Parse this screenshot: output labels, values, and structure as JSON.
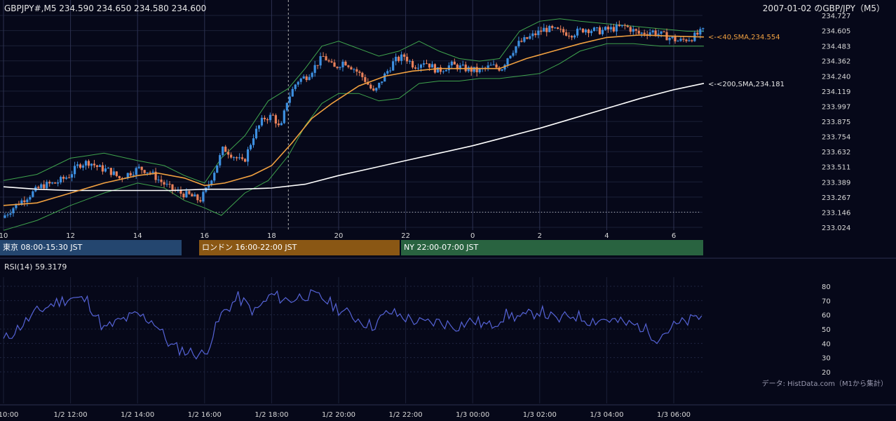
{
  "header": {
    "symbol_ohlc": "GBPJPY#,M5 234.590 234.650 234.580 234.600",
    "date_pair": "2007-01-02 のGBP/JPY（M5）"
  },
  "chart_data": [
    {
      "type": "candlestick",
      "title": "GBPJPY#,M5 234.590 234.650 234.580 234.600",
      "ylim": [
        233.024,
        234.727
      ],
      "y_ticks": [
        "234.727",
        "234.605",
        "234.483",
        "234.362",
        "234.240",
        "234.119",
        "233.997",
        "233.875",
        "233.754",
        "233.632",
        "233.511",
        "233.389",
        "233.267",
        "233.146",
        "233.024"
      ],
      "x_ticks": [
        "10",
        "12",
        "14",
        "16",
        "18",
        "20",
        "22",
        "0",
        "2",
        "4",
        "6"
      ],
      "colors": {
        "up": "#3d8fe0",
        "down": "#e8805a",
        "sma40": "#f0a040",
        "sma200": "#ffffff",
        "bollinger": "#3fa34d"
      },
      "indicators": [
        {
          "name": "SMA 40",
          "label": "<-<40,SMA,234.554",
          "last": 234.554,
          "color": "#f0a040"
        },
        {
          "name": "SMA 200",
          "label": "<-<200,SMA,234.181",
          "last": 234.181,
          "color": "#ffffff"
        },
        {
          "name": "Bollinger Bands",
          "color": "#3fa34d"
        }
      ],
      "reference_line": 233.146,
      "price_path": [
        [
          10.0,
          233.1
        ],
        [
          10.4,
          233.2
        ],
        [
          10.8,
          233.28
        ],
        [
          11.2,
          233.36
        ],
        [
          11.6,
          233.38
        ],
        [
          12.0,
          233.44
        ],
        [
          12.3,
          233.53
        ],
        [
          12.6,
          233.55
        ],
        [
          12.9,
          233.5
        ],
        [
          13.2,
          233.48
        ],
        [
          13.5,
          233.42
        ],
        [
          13.8,
          233.46
        ],
        [
          14.1,
          233.5
        ],
        [
          14.4,
          233.47
        ],
        [
          14.7,
          233.4
        ],
        [
          15.0,
          233.34
        ],
        [
          15.3,
          233.3
        ],
        [
          15.6,
          233.28
        ],
        [
          15.9,
          233.24
        ],
        [
          16.1,
          233.33
        ],
        [
          16.4,
          233.52
        ],
        [
          16.6,
          233.66
        ],
        [
          16.9,
          233.6
        ],
        [
          17.2,
          233.54
        ],
        [
          17.5,
          233.76
        ],
        [
          17.8,
          233.9
        ],
        [
          18.1,
          233.92
        ],
        [
          18.3,
          233.8
        ],
        [
          18.5,
          234.04
        ],
        [
          18.8,
          234.2
        ],
        [
          19.1,
          234.24
        ],
        [
          19.4,
          234.34
        ],
        [
          19.6,
          234.4
        ],
        [
          19.9,
          234.3
        ],
        [
          20.2,
          234.36
        ],
        [
          20.5,
          234.3
        ],
        [
          20.8,
          234.22
        ],
        [
          21.1,
          234.1
        ],
        [
          21.4,
          234.24
        ],
        [
          21.7,
          234.36
        ],
        [
          22.0,
          234.4
        ],
        [
          22.3,
          234.32
        ],
        [
          22.6,
          234.36
        ],
        [
          23.0,
          234.28
        ],
        [
          23.4,
          234.33
        ],
        [
          23.8,
          234.3
        ],
        [
          24.2,
          234.28
        ],
        [
          24.6,
          234.32
        ],
        [
          24.9,
          234.3
        ],
        [
          25.1,
          234.4
        ],
        [
          25.4,
          234.5
        ],
        [
          25.8,
          234.56
        ],
        [
          26.2,
          234.62
        ],
        [
          26.6,
          234.6
        ],
        [
          27.0,
          234.58
        ],
        [
          27.4,
          234.62
        ],
        [
          27.8,
          234.6
        ],
        [
          28.2,
          234.62
        ],
        [
          28.6,
          234.64
        ],
        [
          29.0,
          234.58
        ],
        [
          29.4,
          234.6
        ],
        [
          29.8,
          234.56
        ],
        [
          30.2,
          234.52
        ],
        [
          30.6,
          234.55
        ],
        [
          30.9,
          234.6
        ]
      ],
      "sma40_path": [
        [
          10.0,
          233.2
        ],
        [
          11.0,
          233.22
        ],
        [
          12.0,
          233.3
        ],
        [
          13.0,
          233.38
        ],
        [
          14.0,
          233.44
        ],
        [
          14.6,
          233.46
        ],
        [
          15.4,
          233.42
        ],
        [
          16.0,
          233.36
        ],
        [
          16.6,
          233.38
        ],
        [
          17.4,
          233.44
        ],
        [
          18.0,
          233.52
        ],
        [
          18.6,
          233.7
        ],
        [
          19.2,
          233.9
        ],
        [
          19.8,
          234.02
        ],
        [
          20.6,
          234.16
        ],
        [
          21.4,
          234.24
        ],
        [
          22.2,
          234.28
        ],
        [
          23.0,
          234.3
        ],
        [
          24.0,
          234.3
        ],
        [
          24.8,
          234.3
        ],
        [
          25.6,
          234.38
        ],
        [
          26.4,
          234.44
        ],
        [
          27.2,
          234.5
        ],
        [
          28.0,
          234.55
        ],
        [
          29.0,
          234.57
        ],
        [
          30.0,
          234.56
        ],
        [
          30.9,
          234.554
        ]
      ],
      "sma200_path": [
        [
          10.0,
          233.35
        ],
        [
          11.0,
          233.33
        ],
        [
          12.0,
          233.32
        ],
        [
          13.0,
          233.32
        ],
        [
          14.0,
          233.32
        ],
        [
          15.0,
          233.32
        ],
        [
          16.0,
          233.33
        ],
        [
          17.0,
          233.33
        ],
        [
          18.0,
          233.34
        ],
        [
          19.0,
          233.37
        ],
        [
          20.0,
          233.44
        ],
        [
          21.0,
          233.5
        ],
        [
          22.0,
          233.56
        ],
        [
          23.0,
          233.62
        ],
        [
          24.0,
          233.68
        ],
        [
          25.0,
          233.75
        ],
        [
          26.0,
          233.82
        ],
        [
          27.0,
          233.9
        ],
        [
          28.0,
          233.98
        ],
        [
          29.0,
          234.06
        ],
        [
          30.0,
          234.13
        ],
        [
          30.9,
          234.181
        ]
      ],
      "bollinger_upper_path": [
        [
          10.0,
          233.4
        ],
        [
          11.0,
          233.45
        ],
        [
          12.0,
          233.58
        ],
        [
          13.0,
          233.62
        ],
        [
          14.0,
          233.56
        ],
        [
          14.8,
          233.52
        ],
        [
          15.4,
          233.44
        ],
        [
          16.0,
          233.38
        ],
        [
          16.5,
          233.58
        ],
        [
          17.2,
          233.76
        ],
        [
          17.9,
          234.04
        ],
        [
          18.5,
          234.14
        ],
        [
          19.0,
          234.3
        ],
        [
          19.5,
          234.48
        ],
        [
          20.0,
          234.52
        ],
        [
          20.6,
          234.46
        ],
        [
          21.2,
          234.4
        ],
        [
          21.8,
          234.44
        ],
        [
          22.4,
          234.52
        ],
        [
          23.0,
          234.44
        ],
        [
          23.6,
          234.38
        ],
        [
          24.2,
          234.36
        ],
        [
          24.8,
          234.38
        ],
        [
          25.4,
          234.6
        ],
        [
          26.0,
          234.68
        ],
        [
          26.6,
          234.7
        ],
        [
          27.2,
          234.68
        ],
        [
          28.0,
          234.66
        ],
        [
          28.8,
          234.64
        ],
        [
          29.6,
          234.62
        ],
        [
          30.4,
          234.6
        ],
        [
          30.9,
          234.6
        ]
      ],
      "bollinger_lower_path": [
        [
          10.0,
          233.0
        ],
        [
          11.0,
          233.08
        ],
        [
          12.0,
          233.2
        ],
        [
          13.0,
          233.3
        ],
        [
          14.0,
          233.38
        ],
        [
          14.8,
          233.34
        ],
        [
          15.4,
          233.24
        ],
        [
          16.0,
          233.18
        ],
        [
          16.5,
          233.12
        ],
        [
          17.2,
          233.3
        ],
        [
          17.9,
          233.4
        ],
        [
          18.5,
          233.6
        ],
        [
          19.0,
          233.84
        ],
        [
          19.5,
          234.02
        ],
        [
          20.0,
          234.1
        ],
        [
          20.6,
          234.1
        ],
        [
          21.2,
          234.04
        ],
        [
          21.8,
          234.06
        ],
        [
          22.4,
          234.18
        ],
        [
          23.0,
          234.2
        ],
        [
          23.6,
          234.2
        ],
        [
          24.2,
          234.22
        ],
        [
          24.8,
          234.22
        ],
        [
          25.4,
          234.24
        ],
        [
          26.0,
          234.26
        ],
        [
          26.6,
          234.34
        ],
        [
          27.2,
          234.44
        ],
        [
          28.0,
          234.5
        ],
        [
          28.8,
          234.5
        ],
        [
          29.6,
          234.48
        ],
        [
          30.4,
          234.48
        ],
        [
          30.9,
          234.48
        ]
      ]
    },
    {
      "type": "line",
      "title": "RSI(14) 59.3179",
      "ylim": [
        20,
        80
      ],
      "y_ticks": [
        "80",
        "70",
        "60",
        "50",
        "40",
        "30",
        "20"
      ],
      "x": [
        10.0,
        10.5,
        11.0,
        11.5,
        12.0,
        12.5,
        13.0,
        13.5,
        14.0,
        14.5,
        15.0,
        15.5,
        16.0,
        16.5,
        17.0,
        17.5,
        18.0,
        18.5,
        19.0,
        19.5,
        20.0,
        20.5,
        21.0,
        21.5,
        22.0,
        22.5,
        23.0,
        23.5,
        24.0,
        24.5,
        25.0,
        25.5,
        26.0,
        26.5,
        27.0,
        27.5,
        28.0,
        28.5,
        29.0,
        29.5,
        30.0,
        30.5,
        30.9
      ],
      "values": [
        42,
        52,
        62,
        68,
        72,
        70,
        50,
        56,
        60,
        55,
        38,
        34,
        32,
        60,
        72,
        62,
        74,
        70,
        74,
        72,
        64,
        58,
        52,
        62,
        58,
        54,
        55,
        52,
        56,
        52,
        60,
        58,
        63,
        56,
        60,
        56,
        57,
        54,
        52,
        44,
        52,
        56,
        59.3
      ],
      "color": "#5563d6"
    }
  ],
  "sessions": [
    {
      "label": "東京 08:00-15:30 JST",
      "color": "#24466f"
    },
    {
      "label": "ロンドン 16:00-22:00 JST",
      "color": "#8a5714"
    },
    {
      "label": "NY 22:00-07:00 JST",
      "color": "#296340"
    }
  ],
  "bottom_x_ticks": [
    "10:00",
    "1/2 12:00",
    "1/2 14:00",
    "1/2 16:00",
    "1/2 18:00",
    "1/2 20:00",
    "1/2 22:00",
    "1/3 00:00",
    "1/3 02:00",
    "1/3 04:00",
    "1/3 06:00"
  ],
  "credit": "データ: HistData.com（M1から集計）"
}
